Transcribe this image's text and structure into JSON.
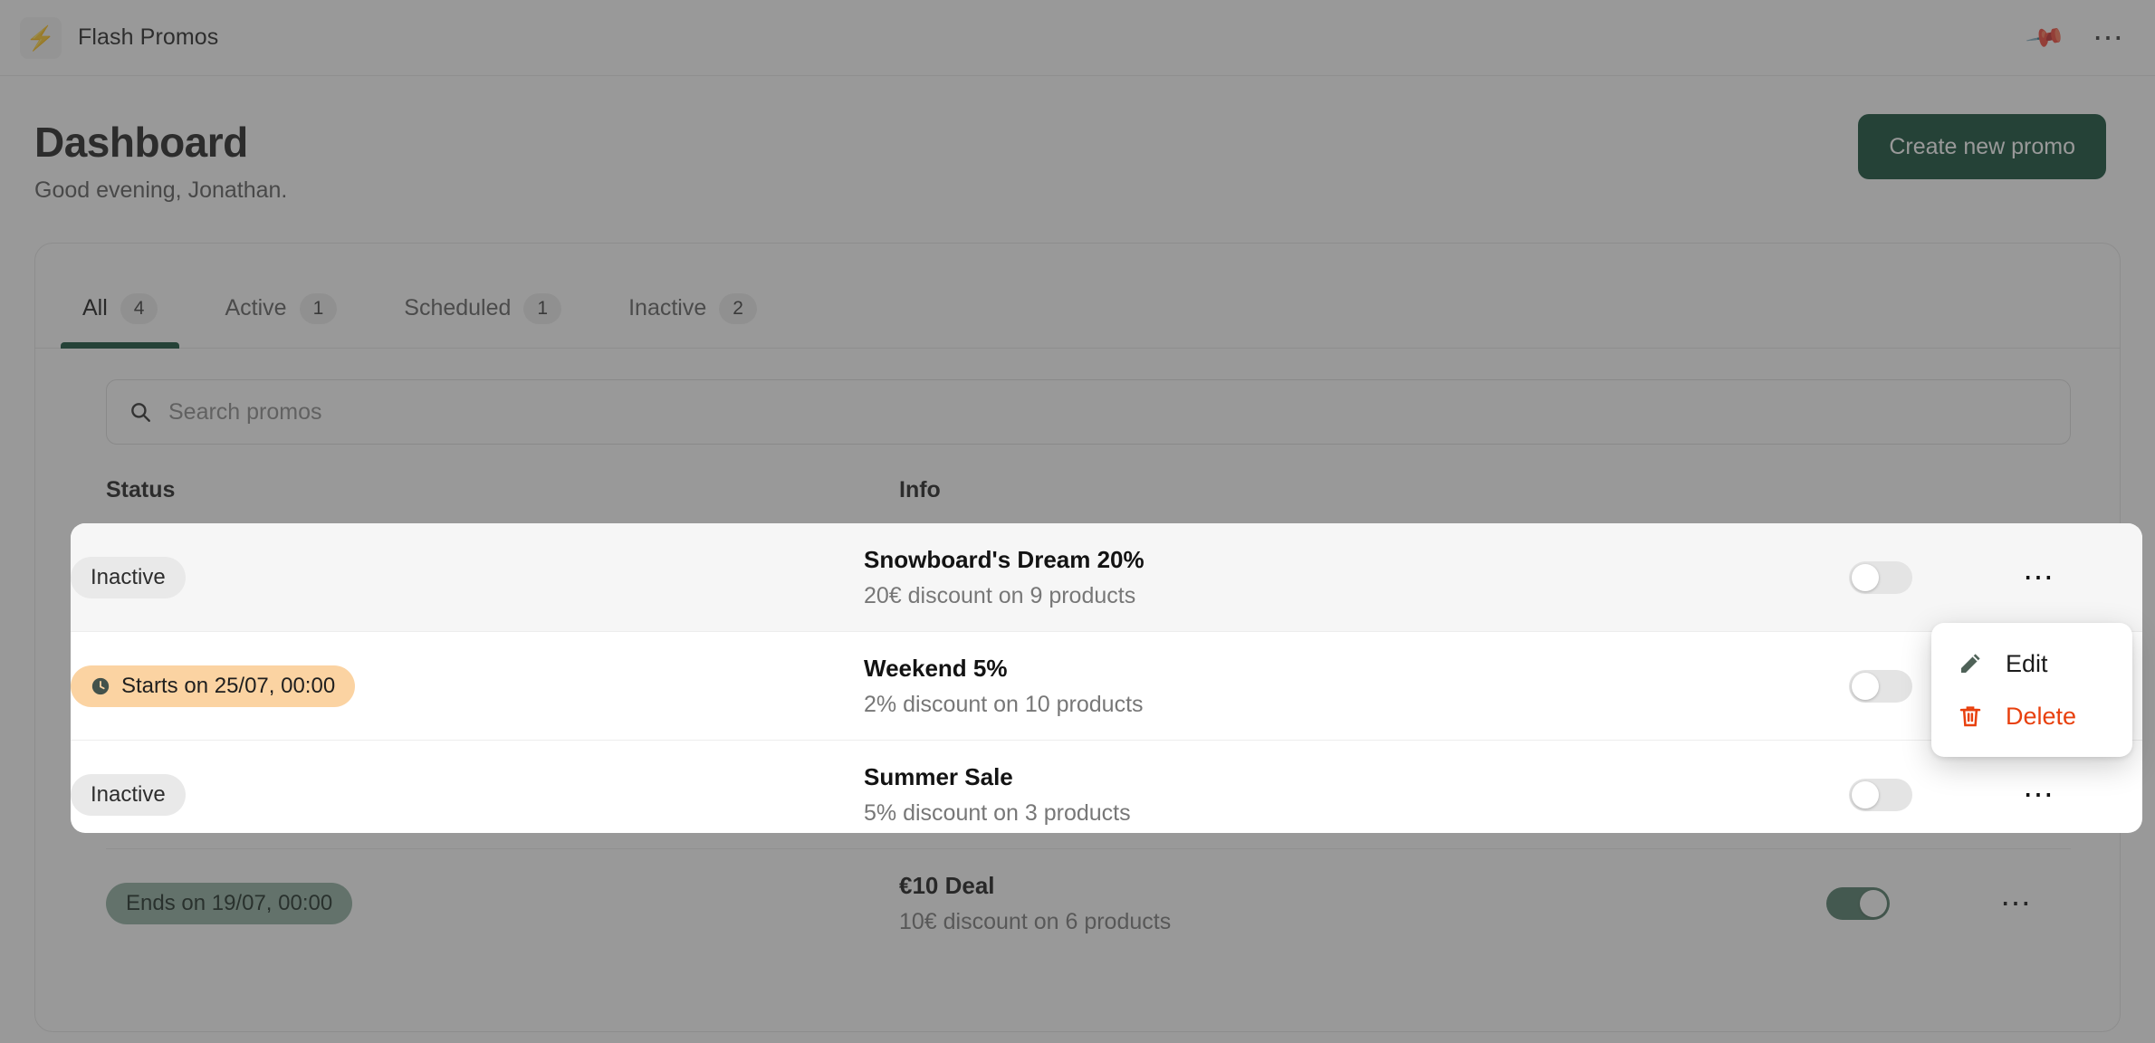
{
  "titlebar": {
    "app_name": "Flash Promos",
    "app_icon": "bolt-icon",
    "pin_icon": "pin-icon",
    "more_icon": "more-horizontal-icon"
  },
  "header": {
    "title": "Dashboard",
    "greeting": "Good evening, Jonathan.",
    "create_button": "Create new promo"
  },
  "tabs": [
    {
      "label": "All",
      "count": "4",
      "active": true
    },
    {
      "label": "Active",
      "count": "1",
      "active": false
    },
    {
      "label": "Scheduled",
      "count": "1",
      "active": false
    },
    {
      "label": "Inactive",
      "count": "2",
      "active": false
    }
  ],
  "search": {
    "placeholder": "Search promos",
    "value": "",
    "icon": "search-icon"
  },
  "table": {
    "columns": [
      "Status",
      "Info"
    ],
    "rows": [
      {
        "status_label": "Inactive",
        "status_type": "inactive",
        "name": "Snowboard's Dream 20%",
        "description": "20€ discount on 9 products",
        "enabled": false
      },
      {
        "status_label": "Starts on 25/07, 00:00",
        "status_type": "scheduled",
        "name": "Weekend 5%",
        "description": "2% discount on 10 products",
        "enabled": false
      },
      {
        "status_label": "Inactive",
        "status_type": "inactive",
        "name": "Summer Sale",
        "description": "5% discount on 3 products",
        "enabled": false
      },
      {
        "status_label": "Ends on 19/07, 00:00",
        "status_type": "ending",
        "name": "€10 Deal",
        "description": "10€ discount on 6 products",
        "enabled": true
      }
    ]
  },
  "context_menu": {
    "items": [
      {
        "label": "Edit",
        "icon": "pencil-icon"
      },
      {
        "label": "Delete",
        "icon": "trash-icon"
      }
    ]
  },
  "colors": {
    "brand_green": "#0d4a33",
    "toggle_on": "#4f7a66",
    "badge_scheduled": "#fbd3a2",
    "badge_ending": "#8fada0",
    "badge_inactive": "#e9e9e9",
    "delete_red": "#e8400e",
    "bolt_gold": "#c08a43"
  }
}
